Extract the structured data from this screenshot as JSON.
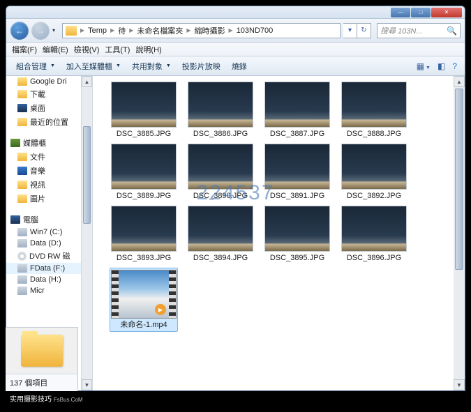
{
  "titlebar": {
    "min": "—",
    "max": "□",
    "close": "✕"
  },
  "nav": {
    "back": "←",
    "fwd": "→"
  },
  "breadcrumbs": [
    "Temp",
    "待",
    "未命名檔案夾",
    "縮時攝影",
    "103ND700"
  ],
  "address": {
    "refresh": "↻",
    "dropdown": "▾"
  },
  "search": {
    "placeholder": "搜尋 103N..."
  },
  "menus": {
    "file": "檔案(F)",
    "edit": "編輯(E)",
    "view": "檢視(V)",
    "tools": "工具(T)",
    "help": "說明(H)"
  },
  "toolbar": {
    "organize": "組合管理",
    "include": "加入至媒體櫃",
    "share": "共用對象",
    "slideshow": "投影片放映",
    "burn": "燒錄"
  },
  "tree": {
    "gdrive": "Google Dri",
    "downloads": "下載",
    "desktop": "桌面",
    "recent": "最近的位置",
    "libraries": "媒體櫃",
    "docs": "文件",
    "music": "音樂",
    "videos": "視訊",
    "pictures": "圖片",
    "computer": "電腦",
    "win7": "Win7 (C:)",
    "datad": "Data (D:)",
    "dvd": "DVD RW 磁",
    "fdata": "FData (F:)",
    "datah": "Data (H:)",
    "mic": "Micr"
  },
  "files": {
    "r1": [
      "DSC_3885.JPG",
      "DSC_3886.JPG",
      "DSC_3887.JPG",
      "DSC_3888.JPG"
    ],
    "r2": [
      "DSC_3889.JPG",
      "DSC_3890.JPG",
      "DSC_3891.JPG",
      "DSC_3892.JPG"
    ],
    "r3": [
      "DSC_3893.JPG",
      "DSC_3894.JPG",
      "DSC_3895.JPG",
      "DSC_3896.JPG"
    ],
    "video": "未命名-1.mp4"
  },
  "status": {
    "count": "137 個項目"
  },
  "watermark": {
    "center": "224537",
    "corner": "实用摄影技巧",
    "corner_url": "FsBus.CoM"
  }
}
